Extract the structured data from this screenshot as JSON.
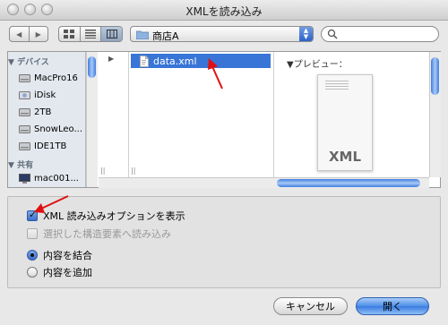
{
  "window": {
    "title": "XMLを読み込み"
  },
  "toolbar": {
    "back_icon": "triangle-left",
    "forward_icon": "triangle-right",
    "view_modes": [
      "icon-view",
      "list-view",
      "column-view"
    ],
    "location": "商店A"
  },
  "sidebar": {
    "devices_header": "デバイス",
    "devices": [
      {
        "label": "MacPro16",
        "icon": "hard-drive-icon"
      },
      {
        "label": "iDisk",
        "icon": "idisk-icon"
      },
      {
        "label": "2TB",
        "icon": "hard-drive-icon"
      },
      {
        "label": "SnowLeo...",
        "icon": "hard-drive-icon"
      },
      {
        "label": "IDE1TB",
        "icon": "hard-drive-icon"
      }
    ],
    "shared_header": "共有",
    "shared": [
      {
        "label": "mac001...",
        "icon": "display-icon"
      }
    ]
  },
  "browser": {
    "selected_file": "data.xml",
    "preview_label": "プレビュー：",
    "preview_extension": "XML"
  },
  "options": {
    "show_import_options": "XML 読み込みオプションを表示",
    "show_import_options_checked": true,
    "import_selected_elements": "選択した構造要素へ読み込み",
    "import_selected_elements_enabled": false,
    "merge_contents": "内容を結合",
    "append_contents": "内容を追加",
    "selected_mode": "merge_contents"
  },
  "buttons": {
    "cancel": "キャンセル",
    "open": "開く"
  },
  "colors": {
    "selection": "#3875d7",
    "annotation_arrow": "#e01010",
    "default_button": "#4c8ee8"
  }
}
